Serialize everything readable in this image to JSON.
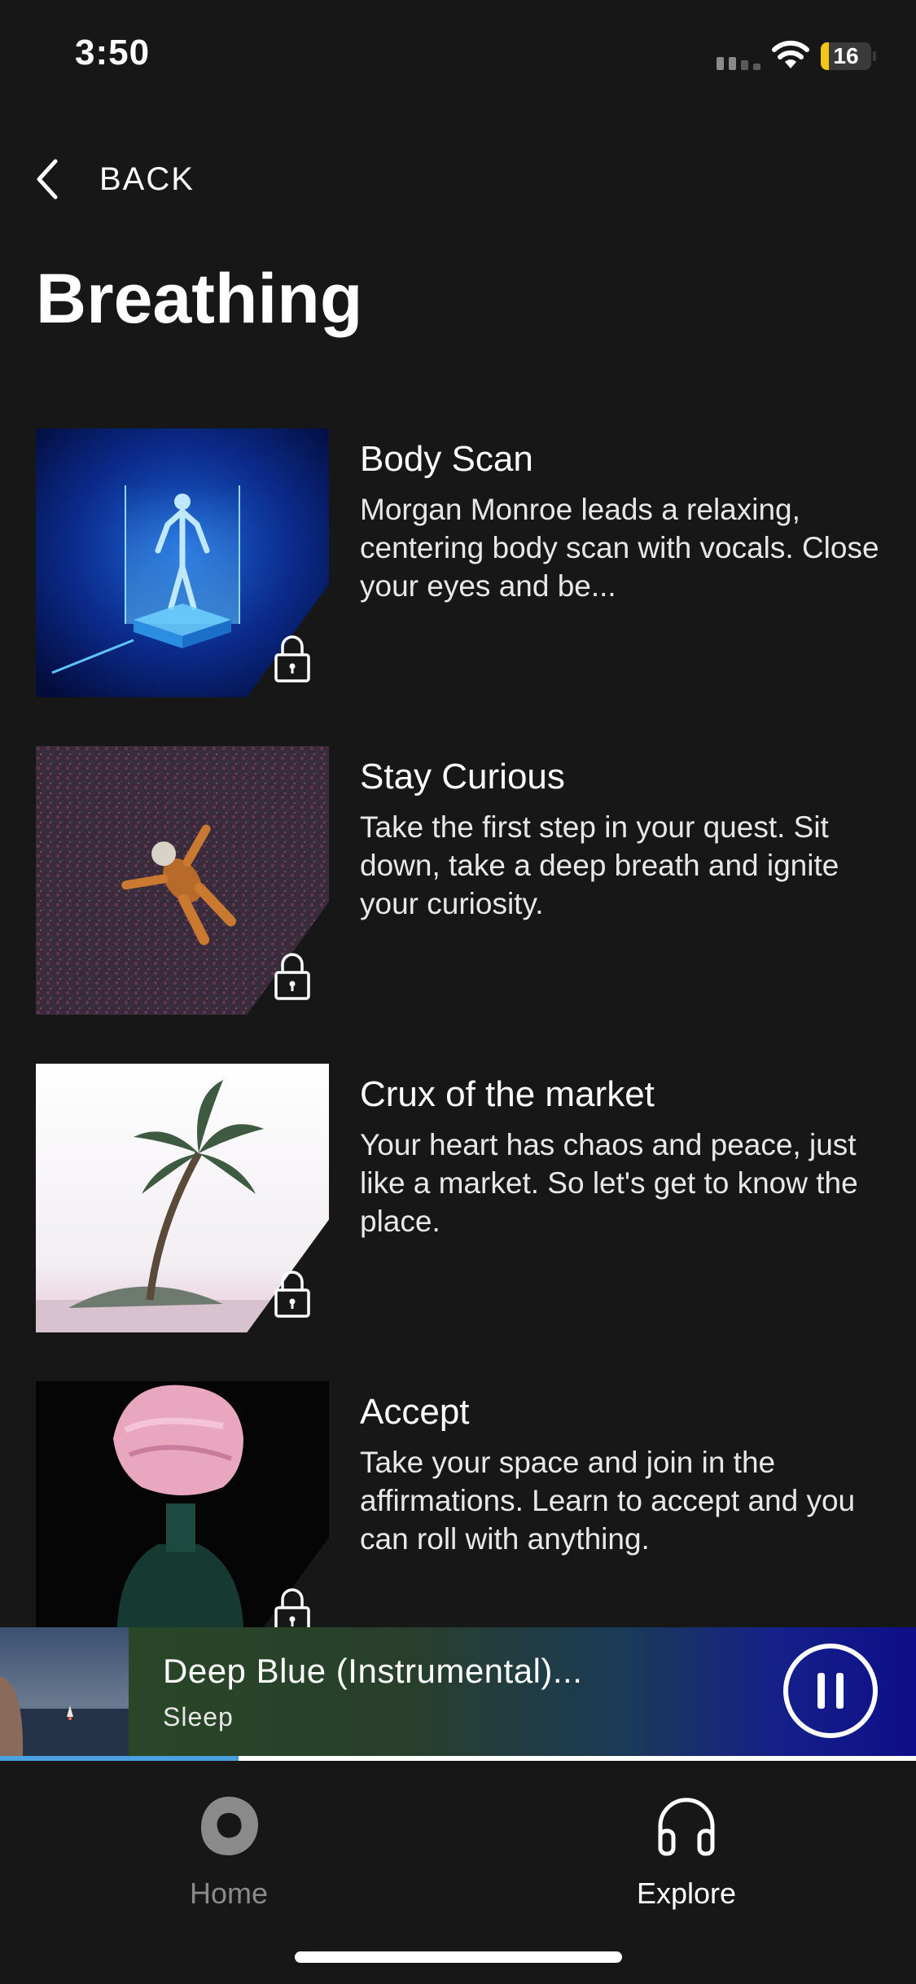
{
  "status_bar": {
    "time": "3:50",
    "battery": "16",
    "battery_level_percent": 16,
    "battery_color": "#f5c518"
  },
  "nav": {
    "back_label": "BACK",
    "back_icon": "chevron-left-icon"
  },
  "page": {
    "title": "Breathing"
  },
  "items": [
    {
      "title": "Body Scan",
      "description": "Morgan Monroe leads a relaxing, centering body scan with vocals. Close your eyes and be...",
      "locked": true,
      "icon": "lock-icon"
    },
    {
      "title": "Stay Curious",
      "description": "Take the first step in your quest. Sit down,  take a deep breath and ignite your curiosity.",
      "locked": true,
      "icon": "lock-icon"
    },
    {
      "title": "Crux of the market",
      "description": "Your heart has chaos and peace,  just like a market. So let's get to know the place.",
      "locked": true,
      "icon": "lock-icon"
    },
    {
      "title": "Accept",
      "description": "Take your space and join in the affirmations. Learn to accept and you can roll with anything.",
      "locked": true,
      "icon": "lock-icon"
    }
  ],
  "player": {
    "title": "Deep Blue (Instrumental)...",
    "subtitle": "Sleep",
    "state": "playing",
    "progress_percent": 26,
    "progress_color": "#4aa0e0",
    "control_icon": "pause-icon"
  },
  "tabs": [
    {
      "label": "Home",
      "icon": "home-blob-icon",
      "active": false
    },
    {
      "label": "Explore",
      "icon": "headphones-icon",
      "active": true
    }
  ]
}
